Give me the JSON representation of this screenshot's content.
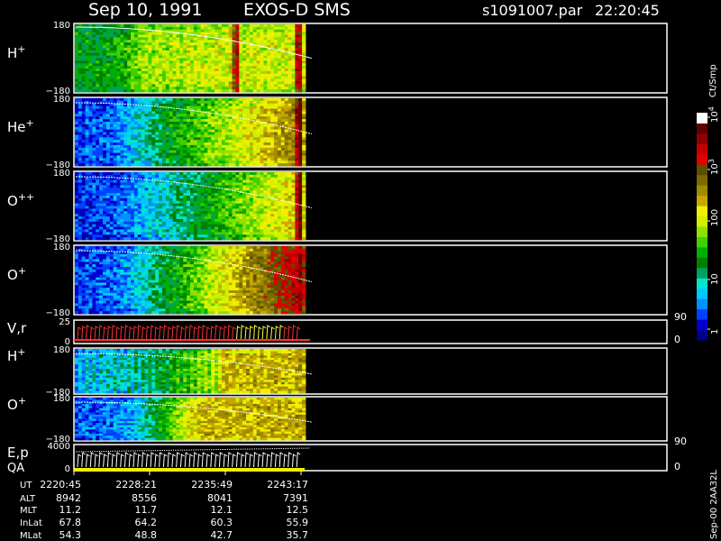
{
  "header": {
    "date": "Sep 10, 1991",
    "instrument": "EXOS-D SMS",
    "file": "s1091007.par",
    "time": "22:20:45"
  },
  "colorbar": {
    "label": "Ct/Smp",
    "ticks": [
      "1",
      "10",
      "100",
      "10",
      "10"
    ],
    "tick_exponents": [
      "",
      "",
      "",
      "3",
      "4"
    ],
    "colors": [
      "#00008b",
      "#0000cd",
      "#0040ff",
      "#0090ff",
      "#00c8ff",
      "#00e5cc",
      "#00a060",
      "#008000",
      "#00b000",
      "#40d000",
      "#90e000",
      "#d0f000",
      "#f0f000",
      "#c8a800",
      "#a08c00",
      "#7a6a00",
      "#5c5000",
      "#e00000",
      "#c00000",
      "#900000",
      "#600000",
      "#ffffff"
    ]
  },
  "chart_data": {
    "type": "heatmap",
    "panels": [
      {
        "label": "H",
        "charge": "+",
        "ymin": "-180",
        "ymax": "180",
        "palette": "warm",
        "columns": [
          7.0,
          7.2,
          6.8,
          7.3,
          7.1,
          6.9,
          7.4,
          7.2,
          7.0,
          7.5,
          7.3,
          7.6,
          7.8,
          8.0,
          8.3,
          8.6,
          9.0,
          9.4,
          9.8,
          10.2,
          10.4,
          10.1,
          9.8,
          10.3,
          10.6,
          10.2,
          9.9,
          10.5,
          11.0,
          10.8,
          10.2,
          10.6,
          11.3,
          10.9,
          10.4,
          10.7,
          11.2,
          10.8,
          10.5,
          10.9,
          11.4,
          11.1,
          10.7,
          11.0,
          12.5,
          16.0,
          17.5,
          11.2,
          10.9,
          11.3,
          10.8,
          11.1,
          11.5,
          11.0,
          10.7,
          11.2,
          11.4,
          11.0,
          10.8,
          11.3,
          11.6,
          11.2,
          11.0,
          17.8,
          17.9,
          11.5
        ]
      },
      {
        "label": "He",
        "charge": "+",
        "ymin": "-180",
        "ymax": "180",
        "palette": "cool",
        "columns": [
          2.0,
          2.2,
          1.9,
          2.4,
          2.1,
          2.3,
          2.0,
          2.5,
          2.2,
          2.6,
          2.4,
          2.8,
          3.0,
          3.2,
          3.5,
          3.8,
          4.1,
          4.4,
          4.7,
          5.0,
          5.3,
          5.6,
          5.9,
          6.2,
          6.4,
          6.7,
          7.0,
          7.2,
          7.4,
          7.6,
          7.8,
          8.0,
          8.2,
          8.4,
          8.6,
          8.8,
          9.0,
          9.2,
          9.4,
          9.6,
          9.8,
          10.0,
          10.2,
          10.4,
          10.6,
          10.8,
          11.0,
          11.2,
          11.4,
          11.6,
          11.8,
          12.0,
          12.2,
          12.4,
          12.6,
          12.8,
          13.0,
          13.2,
          13.4,
          13.6,
          13.8,
          14.0,
          14.2,
          18.5,
          21.0,
          13.0
        ]
      },
      {
        "label": "O",
        "charge": "++",
        "ymin": "-180",
        "ymax": "180",
        "palette": "cool",
        "columns": [
          1.5,
          1.8,
          1.6,
          1.9,
          1.7,
          2.0,
          1.8,
          2.1,
          1.9,
          2.2,
          2.0,
          2.3,
          2.5,
          2.6,
          2.8,
          3.0,
          3.2,
          3.4,
          3.6,
          3.8,
          4.0,
          4.2,
          4.4,
          4.6,
          4.8,
          5.0,
          5.2,
          5.4,
          5.6,
          5.8,
          6.0,
          6.2,
          6.4,
          6.6,
          6.8,
          7.0,
          7.2,
          7.4,
          7.6,
          7.8,
          8.0,
          8.2,
          8.4,
          8.6,
          8.8,
          9.0,
          9.2,
          9.4,
          9.6,
          9.8,
          10.0,
          10.2,
          10.4,
          10.6,
          10.8,
          11.0,
          11.2,
          11.4,
          11.6,
          11.8,
          12.0,
          12.2,
          12.4,
          17.5,
          20.5,
          12.0
        ]
      },
      {
        "label": "O",
        "charge": "+",
        "ymin": "-180",
        "ymax": "180",
        "palette": "cool",
        "columns": [
          1.8,
          2.0,
          1.9,
          2.2,
          2.0,
          2.3,
          2.1,
          2.4,
          2.2,
          2.5,
          2.4,
          2.7,
          2.9,
          3.1,
          3.4,
          3.6,
          3.9,
          4.2,
          4.5,
          4.8,
          5.1,
          5.4,
          5.7,
          6.0,
          6.3,
          6.6,
          6.9,
          7.2,
          7.5,
          7.8,
          8.1,
          8.4,
          8.7,
          9.0,
          9.3,
          9.6,
          9.9,
          10.2,
          10.5,
          10.8,
          11.1,
          11.4,
          11.7,
          12.0,
          12.3,
          12.6,
          12.9,
          13.2,
          13.5,
          13.8,
          14.1,
          14.4,
          14.7,
          15.0,
          15.3,
          15.6,
          15.9,
          16.2,
          16.5,
          16.8,
          17.1,
          17.4,
          17.7,
          18.5,
          19.5,
          17.0
        ]
      },
      {
        "label": "V,r",
        "charge": "",
        "ymin": "0",
        "ymax": "25",
        "right_top": "90",
        "right_bottom": "0",
        "kind": "vector"
      },
      {
        "label": "H",
        "charge": "+",
        "ymin": "-180",
        "ymax": "180",
        "palette": "mixed",
        "columns": [
          3.0,
          4.5,
          3.2,
          4.8,
          3.4,
          5.0,
          3.6,
          5.2,
          3.8,
          5.4,
          4.0,
          5.6,
          4.2,
          5.8,
          4.4,
          6.0,
          4.6,
          6.2,
          4.8,
          6.4,
          5.0,
          6.6,
          5.5,
          7.0,
          6.0,
          7.5,
          6.5,
          8.0,
          7.0,
          8.5,
          7.5,
          9.0,
          8.0,
          9.5,
          8.5,
          10.0,
          9.0,
          10.5,
          9.5,
          11.0,
          10.0,
          11.5,
          12.5,
          13.0,
          12.8,
          13.2,
          12.6,
          13.1,
          12.9,
          13.3,
          12.7,
          13.0,
          12.8,
          13.2,
          12.6,
          13.1,
          12.9,
          13.3,
          12.7,
          13.0,
          12.8,
          13.2,
          12.6,
          13.5,
          13.8,
          13.0
        ]
      },
      {
        "label": "O",
        "charge": "+",
        "ymin": "-180",
        "ymax": "180",
        "palette": "mixed",
        "columns": [
          2.0,
          2.3,
          2.1,
          2.5,
          2.2,
          2.6,
          2.4,
          2.8,
          2.5,
          3.0,
          2.7,
          3.2,
          3.0,
          3.5,
          3.3,
          3.8,
          3.6,
          4.2,
          4.5,
          5.0,
          5.5,
          6.0,
          6.5,
          7.0,
          7.5,
          8.0,
          8.5,
          9.0,
          9.5,
          10.0,
          10.5,
          11.0,
          11.5,
          12.0,
          12.3,
          12.6,
          12.9,
          13.0,
          13.1,
          13.0,
          13.2,
          13.1,
          13.0,
          13.2,
          13.1,
          13.0,
          13.2,
          13.1,
          13.0,
          13.2,
          13.1,
          13.0,
          13.2,
          13.1,
          13.0,
          13.2,
          13.1,
          13.0,
          13.2,
          13.1,
          13.0,
          13.2,
          13.1,
          13.3,
          13.4,
          13.0
        ]
      },
      {
        "label": "E,p",
        "label2": "QA",
        "charge": "",
        "ymin": "0",
        "ymax": "4000",
        "right_top": "90",
        "right_bottom": "0",
        "kind": "vector"
      }
    ],
    "x": [
      "2220:45",
      "2228:21",
      "2235:49",
      "2243:17"
    ],
    "orbit_rows": [
      {
        "label": "UT",
        "values": [
          "2220:45",
          "2228:21",
          "2235:49",
          "2243:17"
        ]
      },
      {
        "label": "ALT",
        "values": [
          "8942",
          "8556",
          "8041",
          "7391"
        ]
      },
      {
        "label": "MLT",
        "values": [
          "11.2",
          "11.7",
          "12.1",
          "12.5"
        ]
      },
      {
        "label": "InLat",
        "values": [
          "67.8",
          "64.2",
          "60.3",
          "55.9"
        ]
      },
      {
        "label": "MLat",
        "values": [
          "54.3",
          "48.8",
          "42.7",
          "35.7"
        ]
      }
    ]
  },
  "footer": {
    "side_text": "Sep-00  2AA32L"
  }
}
